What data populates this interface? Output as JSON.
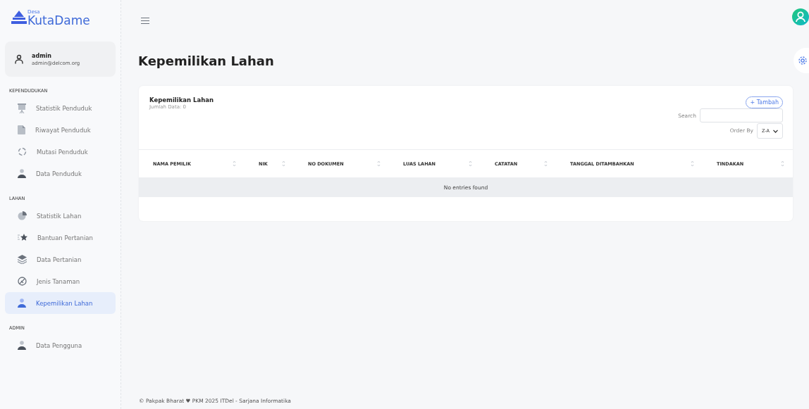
{
  "brand": {
    "small": "Desa",
    "name": "KutaDame"
  },
  "user": {
    "name": "admin",
    "email": "admin@delcom.org"
  },
  "sidebar": [
    {
      "heading": "KEPENDUDUKAN",
      "items": [
        {
          "label": "Statistik Penduduk",
          "selected": false
        },
        {
          "label": "Riwayat Penduduk",
          "selected": false
        },
        {
          "label": "Mutasi Penduduk",
          "selected": false
        },
        {
          "label": "Data Penduduk",
          "selected": false
        }
      ]
    },
    {
      "heading": "LAHAN",
      "items": [
        {
          "label": "Statistik Lahan",
          "selected": false
        },
        {
          "label": "Bantuan Pertanian",
          "selected": false
        },
        {
          "label": "Data Pertanian",
          "selected": false
        },
        {
          "label": "Jenis Tanaman",
          "selected": false
        },
        {
          "label": "Kepemilikan Lahan",
          "selected": true
        }
      ]
    },
    {
      "heading": "ADMIN",
      "items": [
        {
          "label": "Data Pengguna",
          "selected": false
        }
      ]
    }
  ],
  "page_title": "Kepemilikan Lahan",
  "card": {
    "title": "Kepemilikan Lahan",
    "count": "Jumlah Data: 0",
    "add_button": "+ Tambah",
    "search_label": "Search",
    "order_label": "Order By",
    "order_value": "Z-A"
  },
  "table": {
    "columns": [
      "NAMA PEMILIK",
      "NIK",
      "NO DOKUMEN",
      "LUAS LAHAN",
      "CATATAN",
      "TANGGAL DITAMBAHKAN",
      "TINDAKAN"
    ],
    "empty": "No entries found"
  },
  "footer": "© Pakpak Bharat ♥ PKM 2025 ITDel - Sarjana Informatika"
}
